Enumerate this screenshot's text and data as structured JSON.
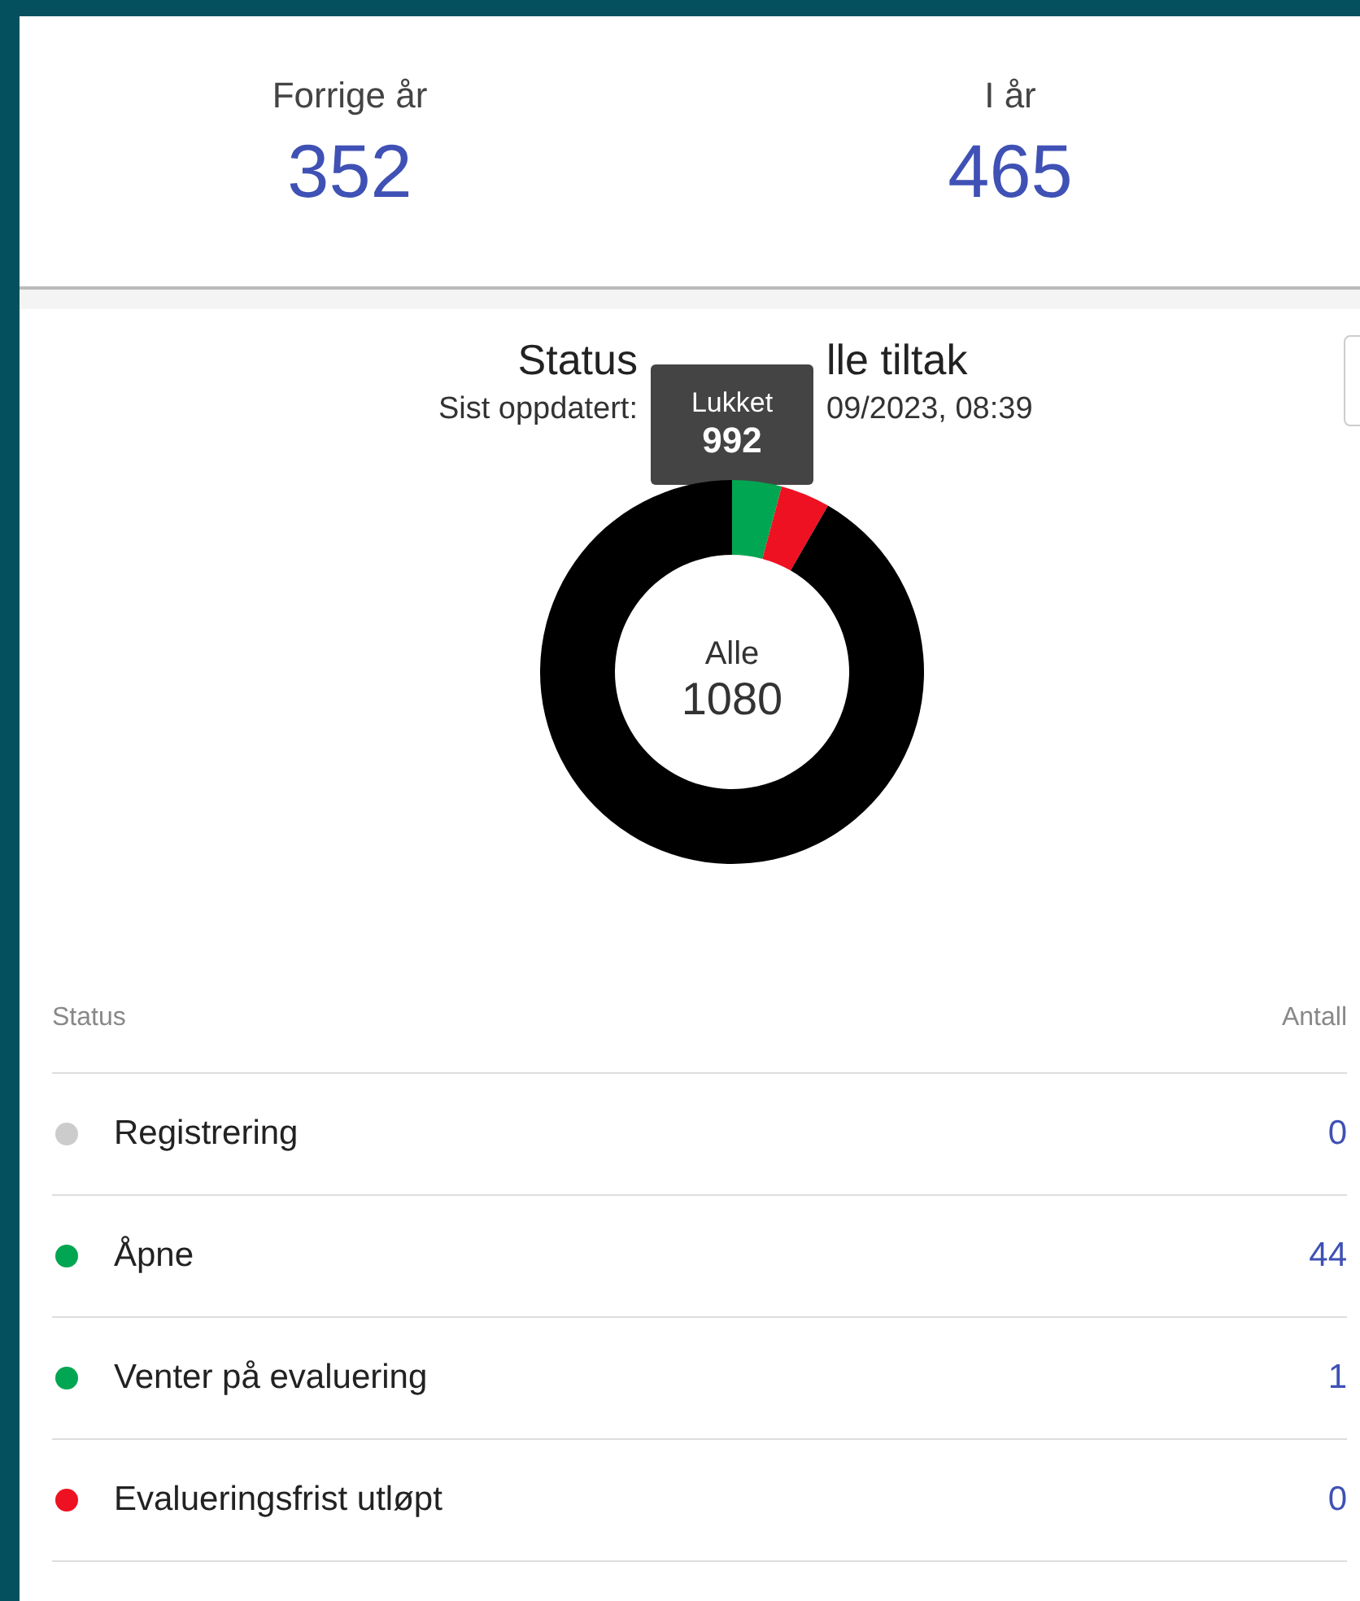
{
  "stats": [
    {
      "label": "Forrige år",
      "value": "352"
    },
    {
      "label": "I år",
      "value": "465"
    }
  ],
  "chart": {
    "title_parts": [
      "Status",
      "lle tiltak"
    ],
    "subtitle_parts": [
      "Sist oppdatert:",
      "09/2023, 08:39"
    ],
    "center_label": "Alle",
    "center_value": "1080",
    "tooltip": {
      "label": "Lukket",
      "value": "992"
    }
  },
  "table": {
    "columns": [
      "Status",
      "Antall"
    ],
    "rows": [
      {
        "status": "Registrering",
        "count": "0",
        "color": "#cccccc"
      },
      {
        "status": "Åpne",
        "count": "44",
        "color": "#00a651"
      },
      {
        "status": "Venter på evaluering",
        "count": "1",
        "color": "#00a651"
      },
      {
        "status": "Evalueringsfrist utløpt",
        "count": "0",
        "color": "#ee1122"
      }
    ]
  }
}
